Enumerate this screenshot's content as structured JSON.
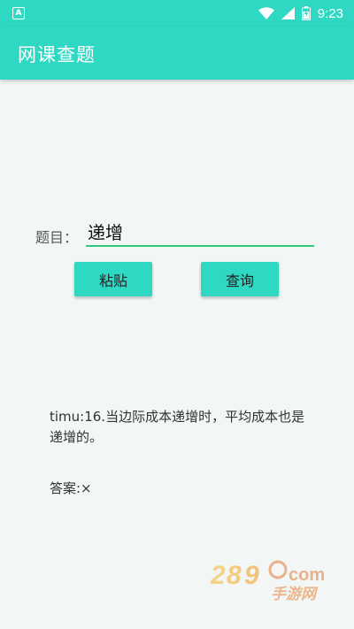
{
  "status_bar": {
    "time": "9:23",
    "left_icon": "A",
    "icons": [
      "wifi-icon",
      "signal-icon",
      "battery-icon"
    ]
  },
  "app_bar": {
    "title": "网课查题"
  },
  "form": {
    "label": "题目：",
    "input_value": "递增",
    "paste_label": "粘贴",
    "search_label": "查询"
  },
  "result": {
    "question": "timu:16.当边际成本递增时，平均成本也是递增的。",
    "answer": "答案:×"
  },
  "colors": {
    "primary": "#2fd8c2",
    "input_underline": "#2ecb7a",
    "background": "#f2f6f4"
  }
}
